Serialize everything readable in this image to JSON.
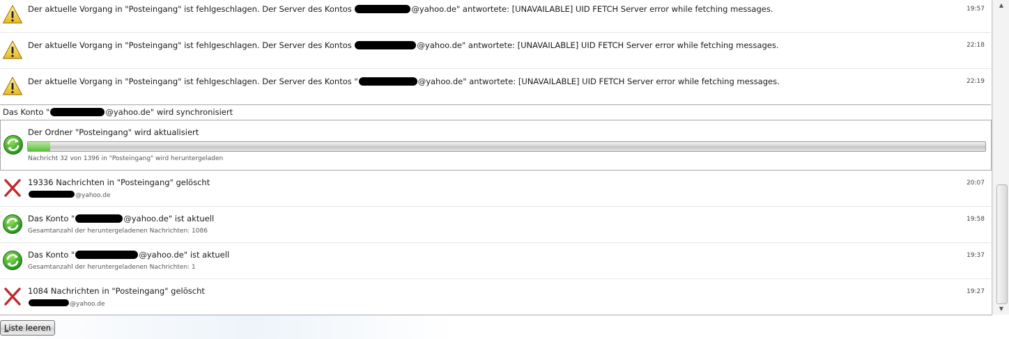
{
  "error_rows": [
    {
      "text_before": "Der aktuelle Vorgang in \"Posteingang\" ist fehlgeschlagen. Der Server des Kontos ",
      "email_domain": "@yahoo.de",
      "text_after": "\" antwortete: [UNAVAILABLE] UID FETCH Server error while fetching messages.",
      "time": "19:57"
    },
    {
      "text_before": "Der aktuelle Vorgang in \"Posteingang\" ist fehlgeschlagen. Der Server des Kontos ",
      "email_domain": "@yahoo.de",
      "text_after": "\" antwortete: [UNAVAILABLE] UID FETCH Server error while fetching messages.",
      "time": "22:18"
    },
    {
      "text_before": "Der aktuelle Vorgang in \"Posteingang\" ist fehlgeschlagen. Der Server des Kontos \"",
      "email_domain": "@yahoo.de",
      "text_after": "\" antwortete: [UNAVAILABLE] UID FETCH Server error while fetching messages.",
      "time": "22:19"
    }
  ],
  "sync_section": {
    "header_before": "Das Konto \"",
    "header_after": "@yahoo.de\" wird synchronisiert",
    "folder_text": "Der Ordner \"Posteingang\" wird aktualisiert",
    "progress_text": "Nachricht 32 von 1396 in \"Posteingang\" wird heruntergeladen",
    "progress_fraction": 0.023
  },
  "activity_rows": [
    {
      "kind": "delete",
      "title": "19336 Nachrichten in \"Posteingang\" gelöscht",
      "sub_after": "@yahoo.de",
      "time": "20:07"
    },
    {
      "kind": "sync",
      "title_before": "Das Konto \"",
      "title_after": "@yahoo.de\" ist aktuell",
      "sub": "Gesamtanzahl der heruntergeladenen Nachrichten: 1086",
      "time": "19:58"
    },
    {
      "kind": "sync",
      "title_before": "Das Konto \"",
      "title_after": "@yahoo.de\" ist aktuell",
      "sub": "Gesamtanzahl der heruntergeladenen Nachrichten: 1",
      "time": "19:37"
    },
    {
      "kind": "delete",
      "title": "1084 Nachrichten in \"Posteingang\" gelöscht",
      "sub_after": "@yahoo.de",
      "time": "19:27"
    }
  ],
  "clear_button": {
    "first_letter": "L",
    "rest": "iste leeren"
  },
  "icons": {
    "warning": "warning-icon",
    "sync": "sync-icon",
    "delete": "delete-icon"
  },
  "colors": {
    "warning_yellow": "#f4d03f",
    "sync_green": "#3fae2a",
    "delete_red": "#c0282d"
  }
}
